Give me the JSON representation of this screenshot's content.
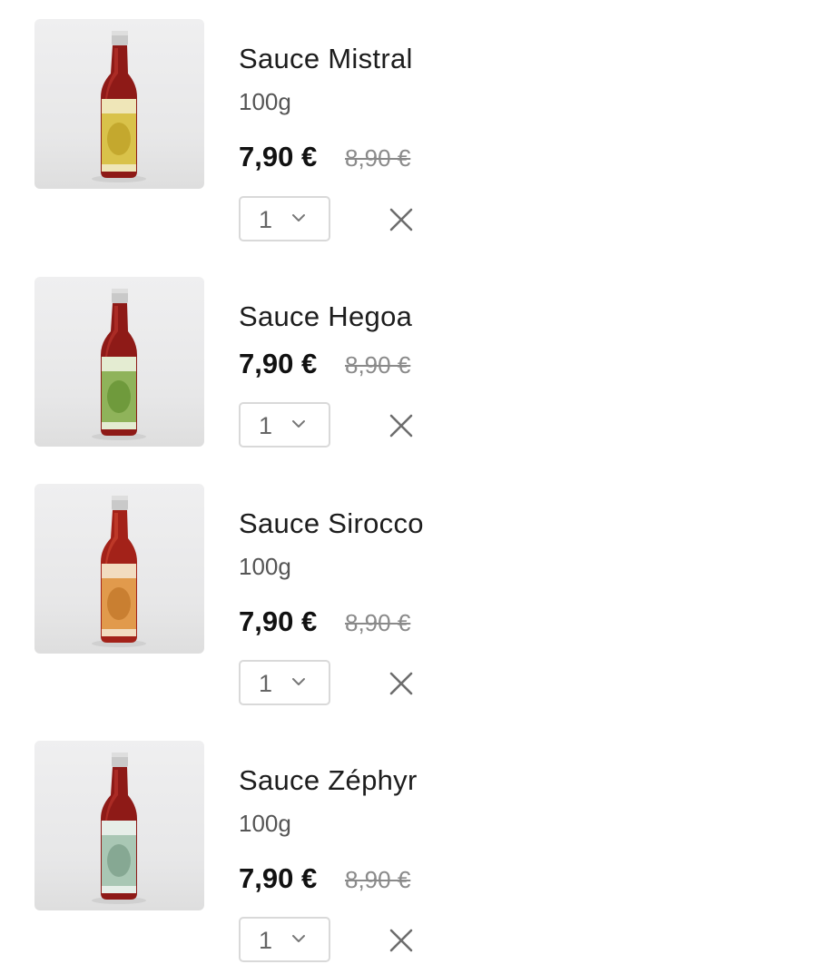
{
  "items": [
    {
      "name": "Sauce Mistral",
      "weight": "100g",
      "price": "7,90 €",
      "old_price": "8,90 €",
      "quantity": "1",
      "label_color": "#d9c24a",
      "label_inner": "#c4a82e"
    },
    {
      "name": "Sauce Hegoa",
      "weight": "",
      "price": "7,90 €",
      "old_price": "8,90 €",
      "quantity": "1",
      "label_color": "#8fb35a",
      "label_inner": "#6f9a3c"
    },
    {
      "name": "Sauce Sirocco",
      "weight": "100g",
      "price": "7,90 €",
      "old_price": "8,90 €",
      "quantity": "1",
      "label_color": "#e19a4c",
      "label_inner": "#c97f31"
    },
    {
      "name": "Sauce Zéphyr",
      "weight": "100g",
      "price": "7,90 €",
      "old_price": "8,90 €",
      "quantity": "1",
      "label_color": "#a9c7b4",
      "label_inner": "#86a893"
    }
  ],
  "icons": {
    "quantity_dropdown": "chevron-down-icon",
    "remove": "close-icon"
  }
}
